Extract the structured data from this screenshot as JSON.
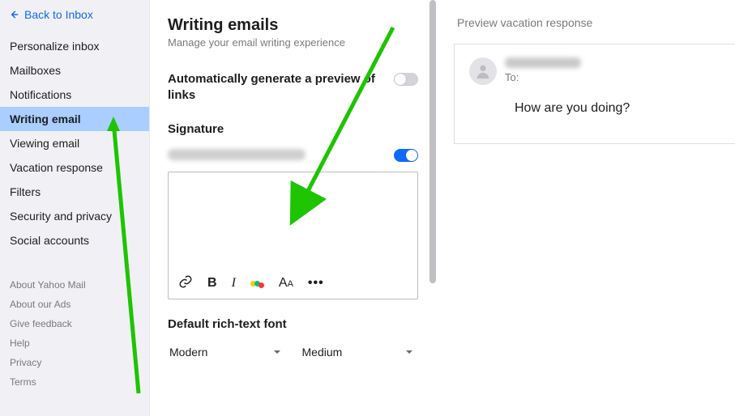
{
  "back_link": "Back to Inbox",
  "sidebar": {
    "items": [
      {
        "label": "Personalize inbox"
      },
      {
        "label": "Mailboxes"
      },
      {
        "label": "Notifications"
      },
      {
        "label": "Writing email",
        "active": true
      },
      {
        "label": "Viewing email"
      },
      {
        "label": "Vacation response"
      },
      {
        "label": "Filters"
      },
      {
        "label": "Security and privacy"
      },
      {
        "label": "Social accounts"
      }
    ],
    "secondary": [
      {
        "label": "About Yahoo Mail"
      },
      {
        "label": "About our Ads"
      },
      {
        "label": "Give feedback"
      },
      {
        "label": "Help"
      },
      {
        "label": "Privacy"
      },
      {
        "label": "Terms"
      }
    ]
  },
  "main": {
    "title": "Writing emails",
    "subtitle": "Manage your email writing experience",
    "auto_preview_label": "Automatically generate a preview of links",
    "auto_preview_on": false,
    "signature_heading": "Signature",
    "signature_account_on": true,
    "default_font_heading": "Default rich-text font",
    "font_family": "Modern",
    "font_size": "Medium"
  },
  "preview": {
    "heading": "Preview vacation response",
    "to_label": "To:",
    "body": "How are you doing?"
  }
}
